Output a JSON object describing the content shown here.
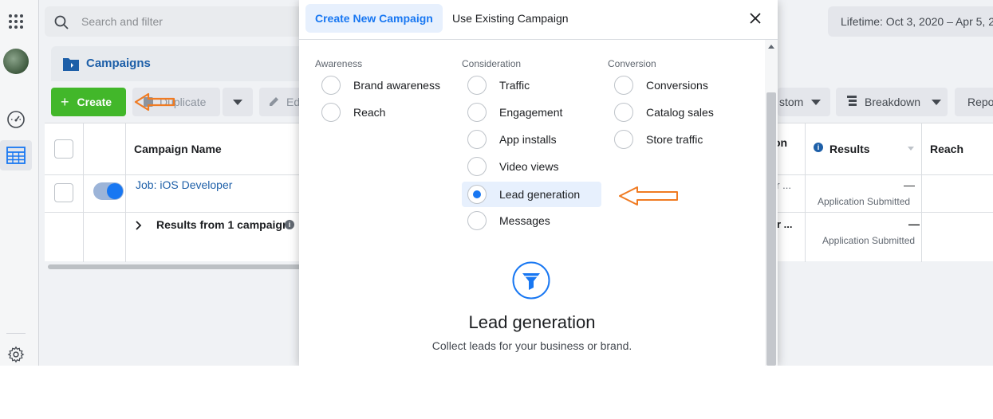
{
  "top": {
    "search_placeholder": "Search and filter",
    "date_range": "Lifetime: Oct 3, 2020 – Apr 5, 2"
  },
  "tab": {
    "campaigns_label": "Campaigns"
  },
  "toolbar": {
    "create_label": "Create",
    "create_plus": "+",
    "duplicate_label": "Duplicate",
    "edit_label": "Ed",
    "custom_label": "stom",
    "breakdown_label": "Breakdown",
    "reports_label": "Repo"
  },
  "table": {
    "headers": {
      "campaign_name": "Campaign Name",
      "delivery_partial": "on",
      "results": "Results",
      "reach": "Reach"
    },
    "rows": [
      {
        "name": "Job: iOS Developer",
        "delivery_partial": "or ...",
        "results_value": "—",
        "results_label": "Application Submitted"
      }
    ],
    "summary": {
      "label": "Results from 1 campaign",
      "delivery_partial": "or ...",
      "results_value": "—",
      "results_label": "Application Submitted"
    }
  },
  "modal": {
    "tabs": {
      "create_new": "Create New Campaign",
      "use_existing": "Use Existing Campaign"
    },
    "columns": [
      {
        "heading": "Awareness",
        "options": [
          "Brand awareness",
          "Reach"
        ]
      },
      {
        "heading": "Consideration",
        "options": [
          "Traffic",
          "Engagement",
          "App installs",
          "Video views",
          "Lead generation",
          "Messages"
        ]
      },
      {
        "heading": "Conversion",
        "options": [
          "Conversions",
          "Catalog sales",
          "Store traffic"
        ]
      }
    ],
    "selected_option": "Lead generation",
    "detail": {
      "title": "Lead generation",
      "description": "Collect leads for your business or brand."
    }
  },
  "colors": {
    "accent_blue": "#1877f2",
    "create_green": "#42b72a",
    "annotation_orange": "#f07b22"
  }
}
